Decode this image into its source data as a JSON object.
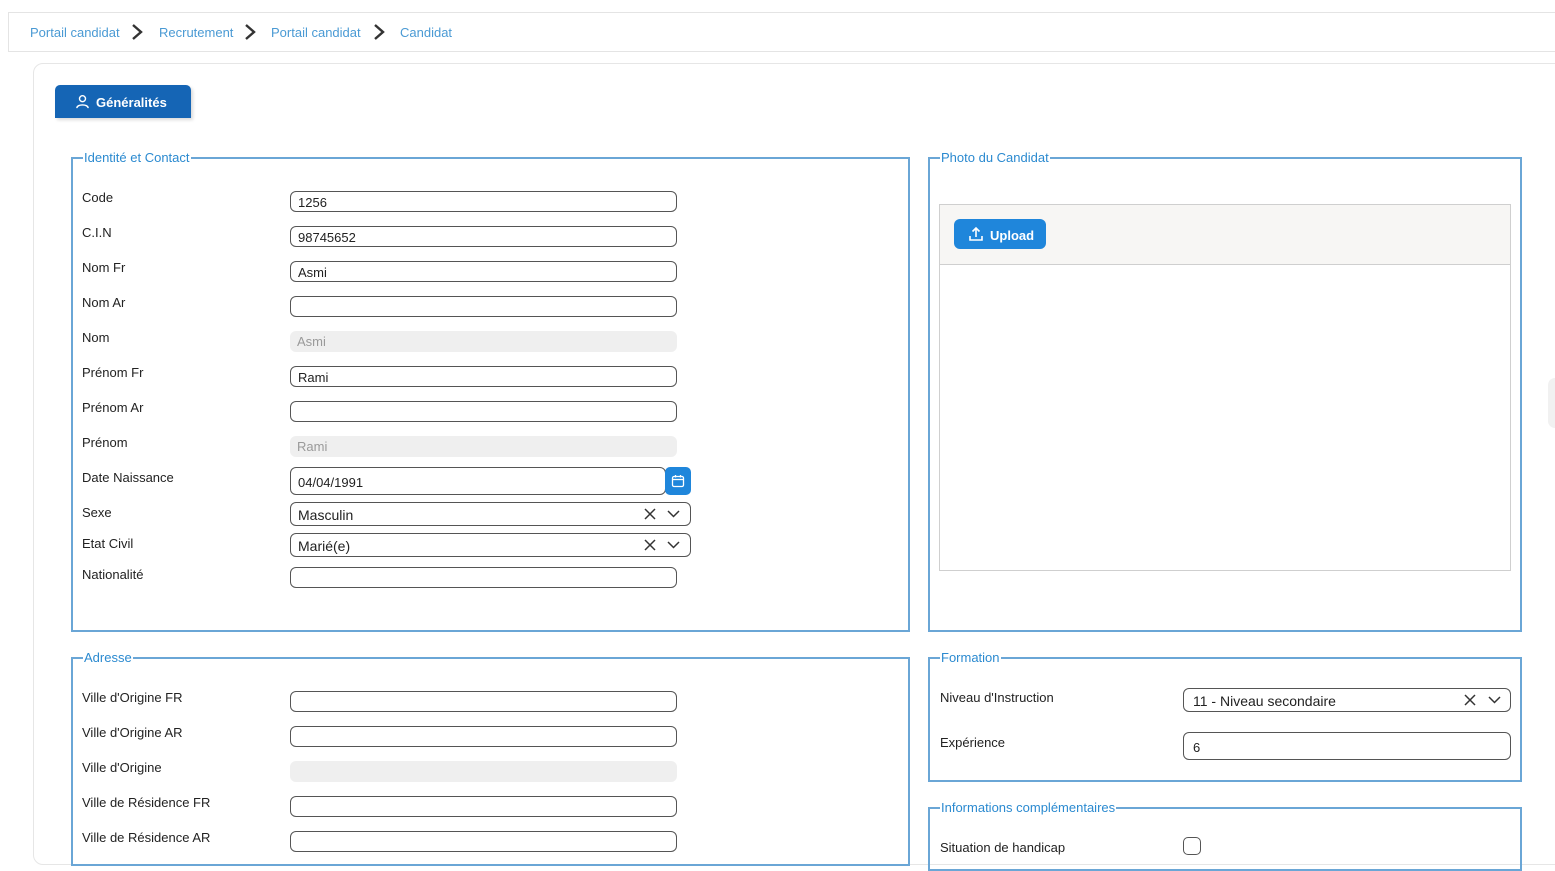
{
  "breadcrumb": {
    "items": [
      "Portail candidat",
      "Recrutement",
      "Portail candidat",
      "Candidat"
    ]
  },
  "tab": {
    "label": "Généralités",
    "icon": "user-icon"
  },
  "identite": {
    "legend": "Identité et Contact",
    "fields": {
      "code": {
        "label": "Code",
        "value": "1256"
      },
      "cin": {
        "label": "C.I.N",
        "value": "98745652"
      },
      "nom_fr": {
        "label": "Nom Fr",
        "value": "Asmi"
      },
      "nom_ar": {
        "label": "Nom Ar",
        "value": ""
      },
      "nom": {
        "label": "Nom",
        "value": "Asmi"
      },
      "prenom_fr": {
        "label": "Prénom Fr",
        "value": "Rami"
      },
      "prenom_ar": {
        "label": "Prénom Ar",
        "value": ""
      },
      "prenom": {
        "label": "Prénom",
        "value": "Rami"
      },
      "date_naissance": {
        "label": "Date Naissance",
        "value": "04/04/1991"
      },
      "sexe": {
        "label": "Sexe",
        "value": "Masculin"
      },
      "etat_civil": {
        "label": "Etat Civil",
        "value": "Marié(e)"
      },
      "nationalite": {
        "label": "Nationalité",
        "value": ""
      }
    }
  },
  "photo": {
    "legend": "Photo du Candidat",
    "upload_label": "Upload",
    "upload_icon": "upload-icon"
  },
  "adresse": {
    "legend": "Adresse",
    "fields": {
      "ville_origine_fr": {
        "label": "Ville d'Origine FR",
        "value": ""
      },
      "ville_origine_ar": {
        "label": "Ville d'Origine AR",
        "value": ""
      },
      "ville_origine": {
        "label": "Ville d'Origine",
        "value": ""
      },
      "ville_residence_fr": {
        "label": "Ville de Résidence FR",
        "value": ""
      },
      "ville_residence_ar": {
        "label": "Ville de Résidence AR",
        "value": ""
      }
    }
  },
  "formation": {
    "legend": "Formation",
    "niveau": {
      "label": "Niveau d'Instruction",
      "value": "11 - Niveau secondaire"
    },
    "experience": {
      "label": "Expérience",
      "value": "6"
    }
  },
  "infos": {
    "legend": "Informations complémentaires",
    "handicap": {
      "label": "Situation de handicap",
      "checked": false
    }
  },
  "colors": {
    "accent": "#1565b5",
    "button": "#1f86db",
    "legend_text": "#2b8ad0",
    "fieldset_border": "#6aa6d6",
    "breadcrumb_link": "#4a9ad4"
  }
}
